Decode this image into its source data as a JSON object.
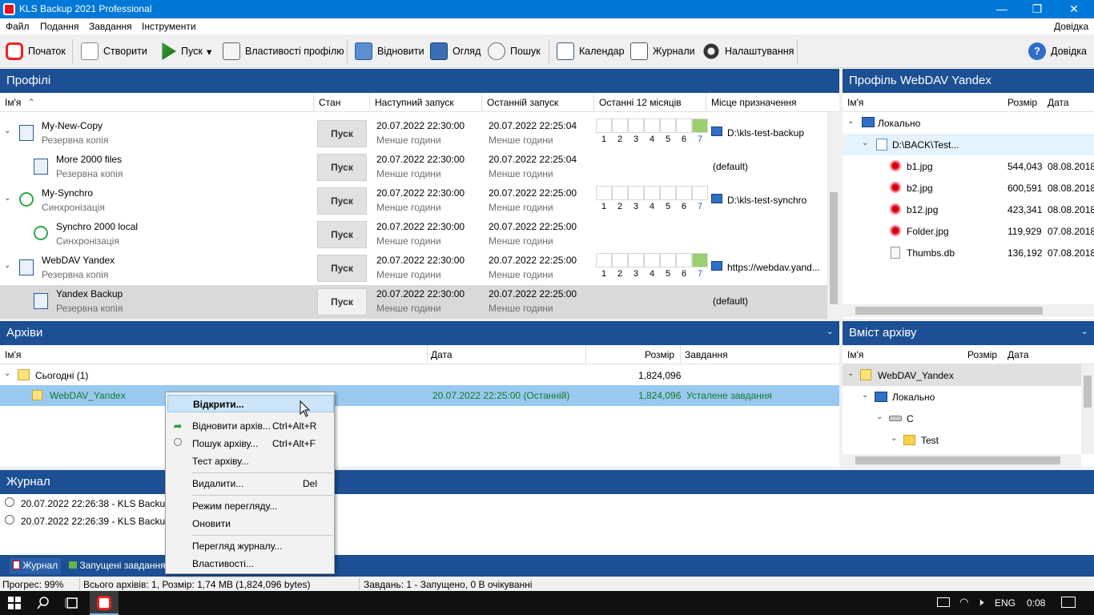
{
  "window": {
    "title": "KLS Backup 2021 Professional",
    "minimize": "—",
    "restore": "❐",
    "close": "✕"
  },
  "menu": {
    "file": "Файл",
    "view": "Подання",
    "tasks": "Завдання",
    "tools": "Інструменти",
    "help": "Довідка"
  },
  "toolbar": {
    "start": "Початок",
    "create": "Створити",
    "run": "Пуск",
    "run_arrow": "▾",
    "profile_props": "Властивості профілю",
    "restore": "Відновити",
    "browse": "Огляд",
    "search": "Пошук",
    "calendar": "Календар",
    "logs": "Журнали",
    "settings": "Налаштування",
    "help": "Довідка"
  },
  "profiles": {
    "title": "Профілі",
    "columns": {
      "name": "Ім'я",
      "state": "Стан",
      "next": "Наступний запуск",
      "last": "Останній запуск",
      "months": "Останні 12 місяців",
      "dest": "Місце призначення"
    },
    "sort_arrow": "⌃",
    "rows": [
      {
        "name": "My-New-Copy",
        "type": "Резервна копія",
        "run": "Пуск",
        "next": "20.07.2022 22:30:00",
        "next_sub": "Менше години",
        "last": "20.07.2022 22:25:04",
        "last_sub": "Менше години",
        "dest": "D:\\kls-test-backup",
        "expander": "⌄"
      },
      {
        "name": "More 2000 files",
        "type": "Резервна копія",
        "run": "Пуск",
        "next": "20.07.2022 22:30:00",
        "next_sub": "Менше години",
        "last": "20.07.2022 22:25:04",
        "last_sub": "Менше години",
        "dest": "(default)"
      },
      {
        "name": "My-Synchro",
        "type": "Синхронізація",
        "run": "Пуск",
        "next": "20.07.2022 22:30:00",
        "next_sub": "Менше години",
        "last": "20.07.2022 22:25:00",
        "last_sub": "Менше години",
        "dest": "D:\\kls-test-synchro",
        "expander": "⌄"
      },
      {
        "name": "Synchro 2000 local",
        "type": "Синхронізація",
        "run": "Пуск",
        "next": "20.07.2022 22:30:00",
        "next_sub": "Менше години",
        "last": "20.07.2022 22:25:00",
        "last_sub": "Менше години",
        "dest": ""
      },
      {
        "name": "WebDAV Yandex",
        "type": "Резервна копія",
        "run": "Пуск",
        "next": "20.07.2022 22:30:00",
        "next_sub": "Менше години",
        "last": "20.07.2022 22:25:00",
        "last_sub": "Менше години",
        "dest": "https://webdav.yand...",
        "expander": "⌄"
      },
      {
        "name": "Yandex Backup",
        "type": "Резервна копія",
        "run": "Пуск",
        "next": "20.07.2022 22:30:00",
        "next_sub": "Менше години",
        "last": "20.07.2022 22:25:00",
        "last_sub": "Менше години",
        "dest": "(default)"
      }
    ],
    "month_labels": [
      "1",
      "2",
      "3",
      "4",
      "5",
      "6",
      "7"
    ]
  },
  "profile_detail": {
    "title": "Профіль WebDAV Yandex",
    "columns": {
      "name": "Ім'я",
      "size": "Розмір",
      "date": "Дата"
    },
    "tree": {
      "local": "Локально",
      "folder": "D:\\BACK\\Test..."
    },
    "files": [
      {
        "name": "b1.jpg",
        "size": "544,043",
        "date": "08.08.2018"
      },
      {
        "name": "b2.jpg",
        "size": "600,591",
        "date": "08.08.2018"
      },
      {
        "name": "b12.jpg",
        "size": "423,341",
        "date": "08.08.2018"
      },
      {
        "name": "Folder.jpg",
        "size": "119,929",
        "date": "07.08.2018"
      },
      {
        "name": "Thumbs.db",
        "size": "136,192",
        "date": "07.08.2018"
      }
    ]
  },
  "archives": {
    "title": "Архіви",
    "columns": {
      "name": "Ім'я",
      "date": "Дата",
      "size": "Розмір",
      "task": "Завдання"
    },
    "group": {
      "name": "Сьогодні (1)",
      "size": "1,824,096"
    },
    "item": {
      "name": "WebDAV_Yandex",
      "date": "20.07.2022 22:25:00 (Останній)",
      "size": "1,824,096",
      "task": "Усталене завдання"
    }
  },
  "archive_content": {
    "title": "Вміст архіву",
    "columns": {
      "name": "Ім'я",
      "size": "Розмір",
      "date": "Дата"
    },
    "tree": [
      "WebDAV_Yandex",
      "Локально",
      "C",
      "Test"
    ]
  },
  "context_menu": {
    "open": "Відкрити...",
    "restore": "Відновити архів...",
    "restore_key": "Ctrl+Alt+R",
    "search": "Пошук архіву...",
    "search_key": "Ctrl+Alt+F",
    "test": "Тест архіву...",
    "delete": "Видалити...",
    "delete_key": "Del",
    "view_mode": "Режим перегляду...",
    "refresh": "Оновити",
    "view_log": "Перегляд журналу...",
    "properties": "Властивості..."
  },
  "log": {
    "title": "Журнал",
    "entries": [
      "20.07.2022 22:26:38 - KLS Backup 20",
      "20.07.2022 22:26:39 - KLS Backup Se"
    ],
    "tabs": {
      "log": "Журнал",
      "running": "Запущені завдання"
    }
  },
  "status": {
    "progress": "Прогрес: 99%",
    "archives": "Всього архівів: 1, Розмір: 1,74 MB (1,824,096 bytes)",
    "tasks": "Завдань: 1 - Запущено, 0 В очікуванні"
  },
  "taskbar": {
    "lang": "ENG",
    "time": "0:08"
  }
}
